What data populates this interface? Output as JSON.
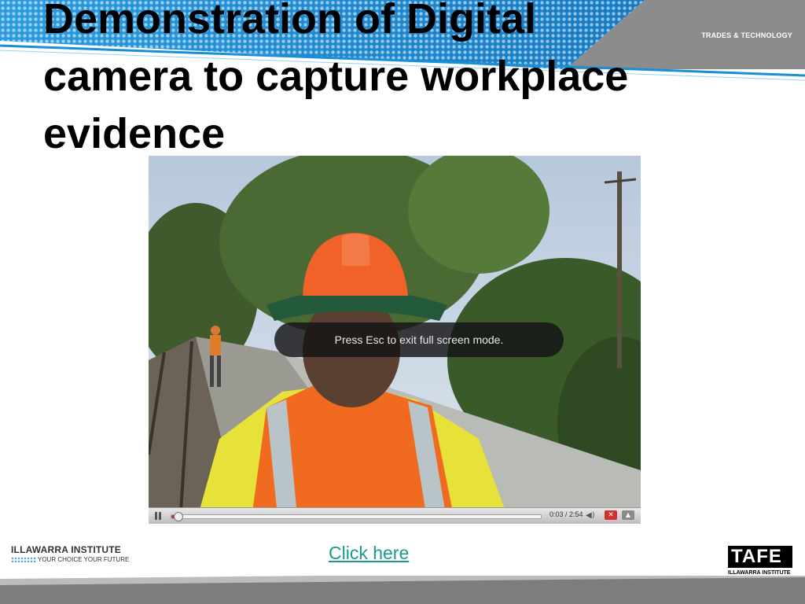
{
  "slide": {
    "title": "Demonstration of Digital\ncamera to capture workplace\nevidence",
    "brand_top": "TRADES & TECHNOLOGY"
  },
  "video": {
    "overlay_text": "Press Esc to exit full screen mode.",
    "time_display": "0:03 / 2:54",
    "progress_fraction": 0.017
  },
  "footer": {
    "link_text": "Click here",
    "left_logo": {
      "name": "ILLAWARRA INSTITUTE",
      "tagline": "YOUR CHOICE YOUR FUTURE"
    },
    "right_logo": {
      "mark": "TAFE",
      "subtitle": "ILLAWARRA INSTITUTE"
    }
  },
  "colors": {
    "banner_blue": "#1b8fd6",
    "banner_grey": "#8c8c8c",
    "link": "#1a9a8a",
    "player_red": "#c62828"
  }
}
